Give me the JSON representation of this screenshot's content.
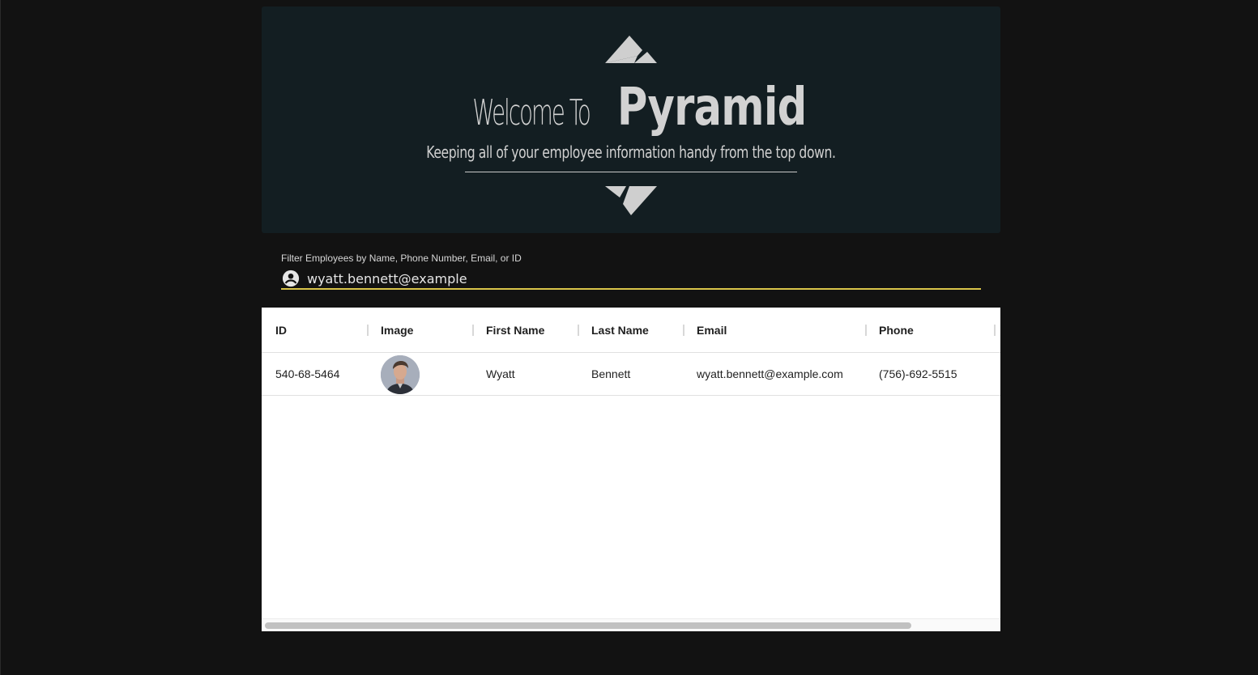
{
  "hero": {
    "title_prefix": "Welcome To",
    "title_brand": "Pyramid",
    "subtitle": "Keeping all of your employee information handy from the top down."
  },
  "filter": {
    "label": "Filter Employees by Name, Phone Number, Email, or ID",
    "value": "wyatt.bennett@example",
    "icon": "account-circle-icon"
  },
  "table": {
    "columns": [
      "ID",
      "Image",
      "First Name",
      "Last Name",
      "Email",
      "Phone"
    ],
    "rows": [
      {
        "id": "540-68-5464",
        "first_name": "Wyatt",
        "last_name": "Bennett",
        "email": "wyatt.bennett@example.com",
        "phone": "(756)-692-5515"
      }
    ]
  },
  "colors": {
    "accent": "#d9c44a",
    "hero_bg": "#131e22",
    "page_bg": "#121212"
  }
}
